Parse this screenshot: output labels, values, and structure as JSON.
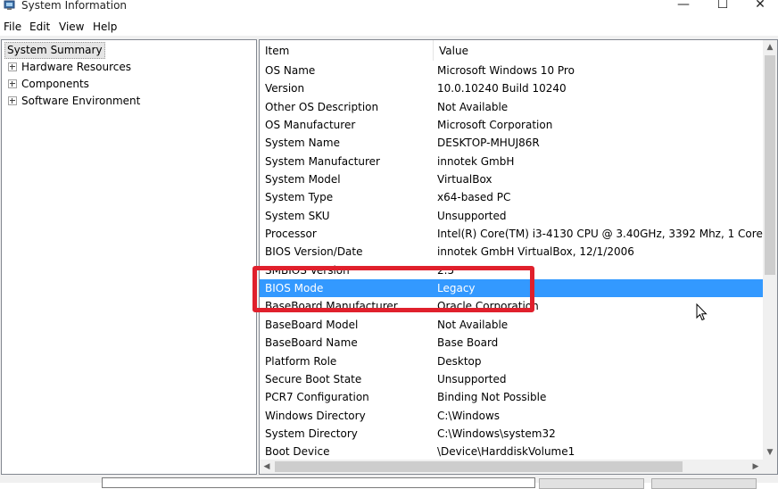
{
  "window": {
    "title": "System Information",
    "controls": {
      "minimize": "—",
      "maximize": "☐",
      "close": "✕"
    }
  },
  "menu": [
    "File",
    "Edit",
    "View",
    "Help"
  ],
  "tree": {
    "root": "System Summary",
    "items": [
      "Hardware Resources",
      "Components",
      "Software Environment"
    ]
  },
  "table": {
    "columns": [
      "Item",
      "Value"
    ],
    "selected_index": 12,
    "rows": [
      {
        "item": "OS Name",
        "value": "Microsoft Windows 10 Pro"
      },
      {
        "item": "Version",
        "value": "10.0.10240 Build 10240"
      },
      {
        "item": "Other OS Description",
        "value": "Not Available"
      },
      {
        "item": "OS Manufacturer",
        "value": "Microsoft Corporation"
      },
      {
        "item": "System Name",
        "value": "DESKTOP-MHUJ86R"
      },
      {
        "item": "System Manufacturer",
        "value": "innotek GmbH"
      },
      {
        "item": "System Model",
        "value": "VirtualBox"
      },
      {
        "item": "System Type",
        "value": "x64-based PC"
      },
      {
        "item": "System SKU",
        "value": "Unsupported"
      },
      {
        "item": "Processor",
        "value": "Intel(R) Core(TM) i3-4130 CPU @ 3.40GHz, 3392 Mhz, 1 Core(s), 1"
      },
      {
        "item": "BIOS Version/Date",
        "value": "innotek GmbH VirtualBox, 12/1/2006"
      },
      {
        "item": "SMBIOS Version",
        "value": "2.5"
      },
      {
        "item": "BIOS Mode",
        "value": "Legacy"
      },
      {
        "item": "BaseBoard Manufacturer",
        "value": "Oracle Corporation"
      },
      {
        "item": "BaseBoard Model",
        "value": "Not Available"
      },
      {
        "item": "BaseBoard Name",
        "value": "Base Board"
      },
      {
        "item": "Platform Role",
        "value": "Desktop"
      },
      {
        "item": "Secure Boot State",
        "value": "Unsupported"
      },
      {
        "item": "PCR7 Configuration",
        "value": "Binding Not Possible"
      },
      {
        "item": "Windows Directory",
        "value": "C:\\Windows"
      },
      {
        "item": "System Directory",
        "value": "C:\\Windows\\system32"
      },
      {
        "item": "Boot Device",
        "value": "\\Device\\HarddiskVolume1"
      }
    ]
  },
  "scrollbar": {
    "up": "▲",
    "down": "▼",
    "left": "◀",
    "right": "▶"
  },
  "colors": {
    "selection": "#3399ff",
    "highlight_box": "#e0202c"
  }
}
